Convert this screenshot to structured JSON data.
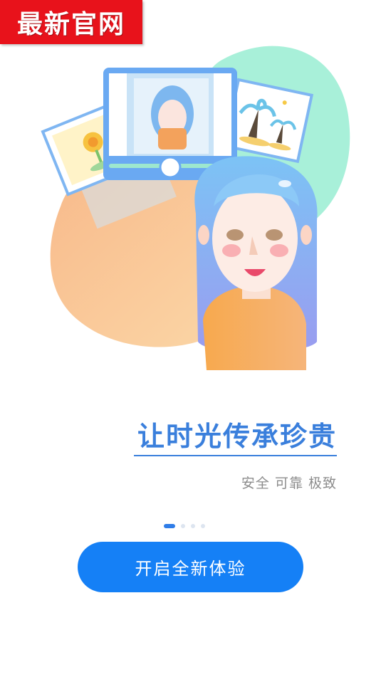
{
  "badge": {
    "text": "最新官网"
  },
  "hero": {
    "title": "让时光传承珍贵",
    "subtitle": "安全 可靠 极致"
  },
  "pager": {
    "count": 4,
    "active_index": 0
  },
  "cta": {
    "label": "开启全新体验"
  },
  "colors": {
    "accent": "#1580f6",
    "title": "#3a7fdc",
    "badge": "#e8121b",
    "subtitle": "#8c8c8c"
  }
}
